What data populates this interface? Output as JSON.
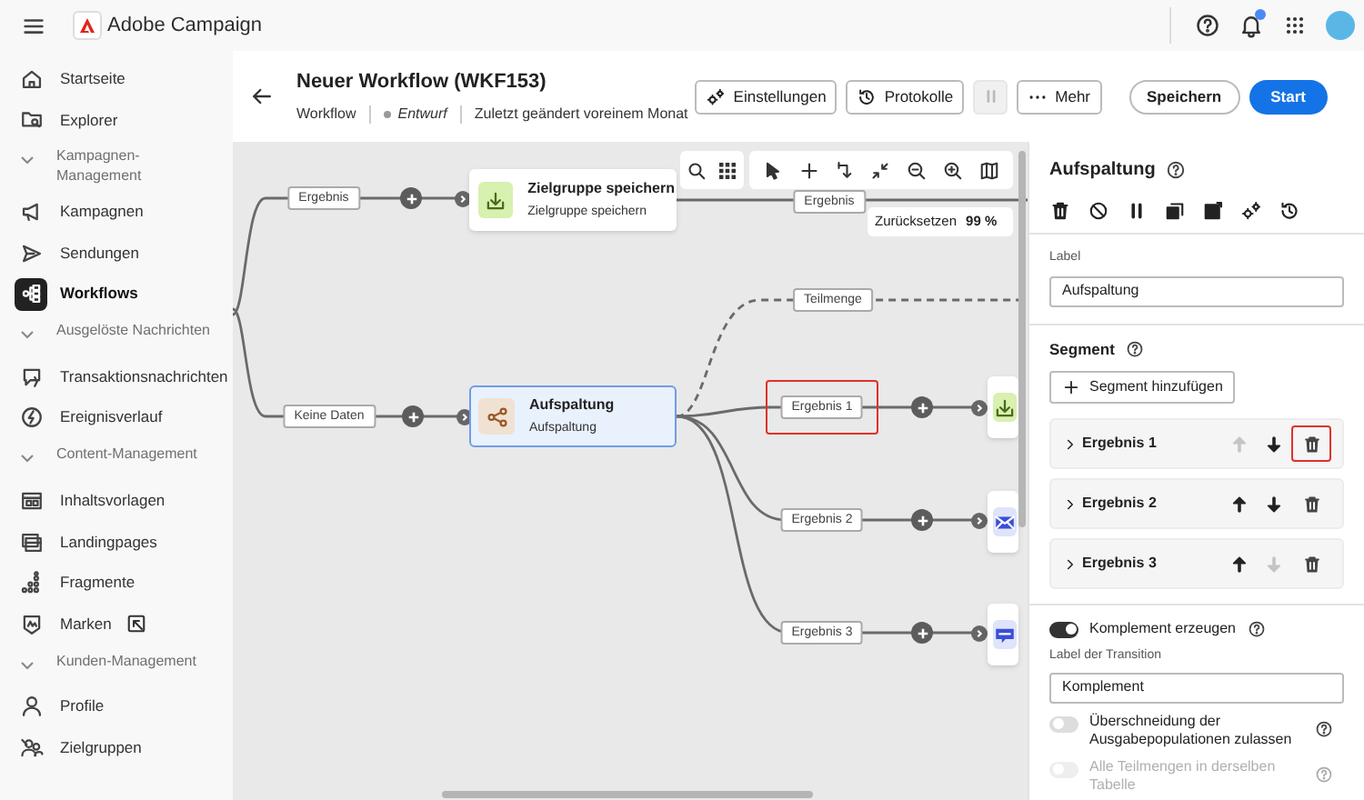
{
  "app_bar": {
    "product": "Adobe Campaign",
    "notifications": true
  },
  "sidebar": {
    "items": [
      {
        "kind": "item",
        "label": "Startseite",
        "selected": false
      },
      {
        "kind": "item",
        "label": "Explorer",
        "selected": false
      },
      {
        "kind": "section",
        "label": "Kampagnen-Management",
        "expanded": true
      },
      {
        "kind": "item",
        "label": "Kampagnen",
        "selected": false
      },
      {
        "kind": "item",
        "label": "Sendungen",
        "selected": false
      },
      {
        "kind": "item",
        "label": "Workflows",
        "selected": true
      },
      {
        "kind": "section",
        "label": "Ausgelöste Nachrichten",
        "expanded": true
      },
      {
        "kind": "item",
        "label": "Transaktionsnachrichten",
        "selected": false
      },
      {
        "kind": "item",
        "label": "Ereignisverlauf",
        "selected": false
      },
      {
        "kind": "section",
        "label": "Content-Management",
        "expanded": true
      },
      {
        "kind": "item",
        "label": "Inhaltsvorlagen",
        "selected": false
      },
      {
        "kind": "item",
        "label": "Landingpages",
        "selected": false
      },
      {
        "kind": "item",
        "label": "Fragmente",
        "selected": false
      },
      {
        "kind": "item",
        "label": "Marken",
        "selected": false,
        "external": true
      },
      {
        "kind": "section",
        "label": "Kunden-Management",
        "expanded": true
      },
      {
        "kind": "item",
        "label": "Profile",
        "selected": false
      },
      {
        "kind": "item",
        "label": "Zielgruppen",
        "selected": false
      }
    ]
  },
  "header": {
    "title": "Neuer Workflow (WKF153)",
    "type": "Workflow",
    "status": "Entwurf",
    "modified": "Zuletzt geändert voreinem Monat",
    "buttons": [
      {
        "kind": "outline",
        "label": "Einstellungen",
        "disabled": false
      },
      {
        "kind": "outline",
        "label": "Protokolle",
        "disabled": false
      },
      {
        "kind": "pause",
        "disabled": true
      },
      {
        "kind": "outline",
        "label": "Mehr",
        "disabled": false
      },
      {
        "kind": "secondary",
        "label": "Speichern",
        "disabled": false
      },
      {
        "kind": "primary",
        "label": "Start",
        "disabled": false
      }
    ]
  },
  "canvas": {
    "zoom_reset": "Zurücksetzen",
    "zoom": "99 %",
    "nodes": [
      {
        "kind": "save",
        "title": "Zielgruppe speichern",
        "subtitle": "Zielgruppe speichern",
        "selected": false
      },
      {
        "kind": "split",
        "title": "Aufspaltung",
        "subtitle": "Aufspaltung",
        "selected": true
      },
      {
        "kind": "save",
        "selected": false
      },
      {
        "kind": "email",
        "selected": false
      },
      {
        "kind": "sms",
        "selected": false
      }
    ],
    "transitions": [
      {
        "label": "Ergebnis",
        "highlighted": false
      },
      {
        "label": "Keine Daten",
        "highlighted": false
      },
      {
        "label": "Ergebnis",
        "highlighted": false
      },
      {
        "label": "Teilmenge",
        "highlighted": false
      },
      {
        "label": "Ergebnis 1",
        "highlighted": true
      },
      {
        "label": "Ergebnis 2",
        "highlighted": false
      },
      {
        "label": "Ergebnis 3",
        "highlighted": false
      }
    ]
  },
  "panel": {
    "title": "Aufspaltung",
    "label_caption": "Label",
    "label_value": "Aufspaltung",
    "segment_heading": "Segment",
    "add_segment": "Segment hinzufügen",
    "segments": [
      {
        "label": "Ergebnis 1",
        "up_disabled": true,
        "down_disabled": false,
        "delete_highlighted": true
      },
      {
        "label": "Ergebnis 2",
        "up_disabled": false,
        "down_disabled": false,
        "delete_highlighted": false
      },
      {
        "label": "Ergebnis 3",
        "up_disabled": false,
        "down_disabled": true,
        "delete_highlighted": false
      }
    ],
    "complement": {
      "label": "Komplement erzeugen",
      "on": true
    },
    "transition_caption": "Label der Transition",
    "transition_value": "Komplement",
    "overlap": {
      "label": "Überschneidung der Ausgabepopulationen zulassen",
      "on": false,
      "disabled": false
    },
    "same_table": {
      "label": "Alle Teilmengen in derselben Tabelle",
      "on": false,
      "disabled": true
    }
  }
}
